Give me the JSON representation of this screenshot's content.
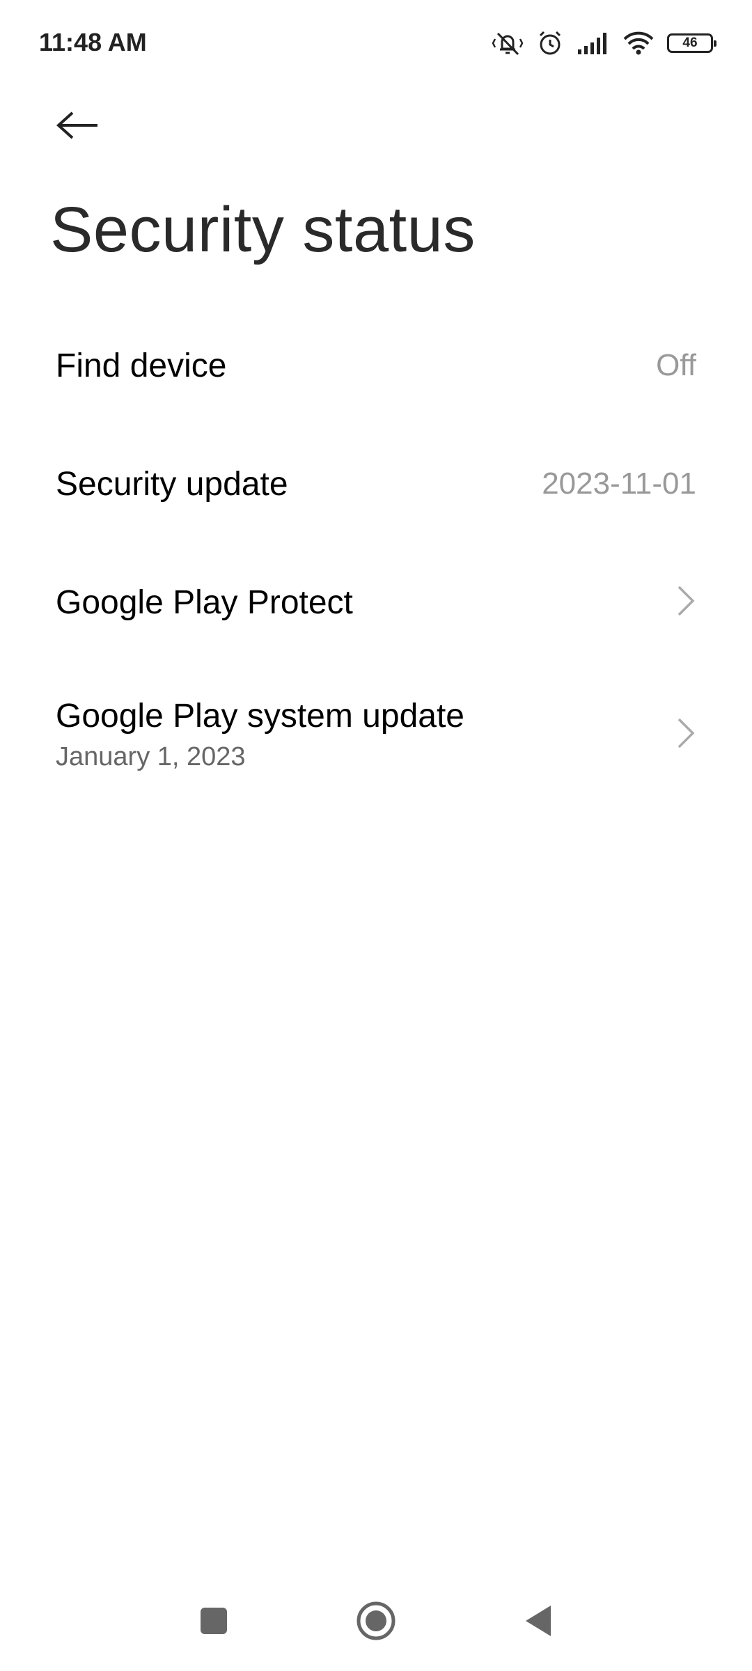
{
  "status_bar": {
    "time": "11:48 AM",
    "battery": "46",
    "icons": [
      "mute-vibrate-icon",
      "alarm-icon",
      "signal-icon",
      "wifi-icon",
      "battery-icon"
    ]
  },
  "header": {
    "back_icon": "arrow-left-icon",
    "title": "Security status"
  },
  "settings": {
    "items": [
      {
        "title": "Find device",
        "value": "Off"
      },
      {
        "title": "Security update",
        "value": "2023-11-01"
      },
      {
        "title": "Google Play Protect",
        "icon": "chevron-right-icon"
      },
      {
        "title": "Google Play system update",
        "subtitle": "January 1, 2023",
        "icon": "chevron-right-icon"
      }
    ]
  },
  "nav_bar": {
    "icons": [
      "recents-square-icon",
      "home-circle-icon",
      "back-triangle-icon"
    ]
  },
  "colors": {
    "background": "#ffffff",
    "text_primary": "#000000",
    "text_secondary": "#666666",
    "value_text": "#999999"
  }
}
